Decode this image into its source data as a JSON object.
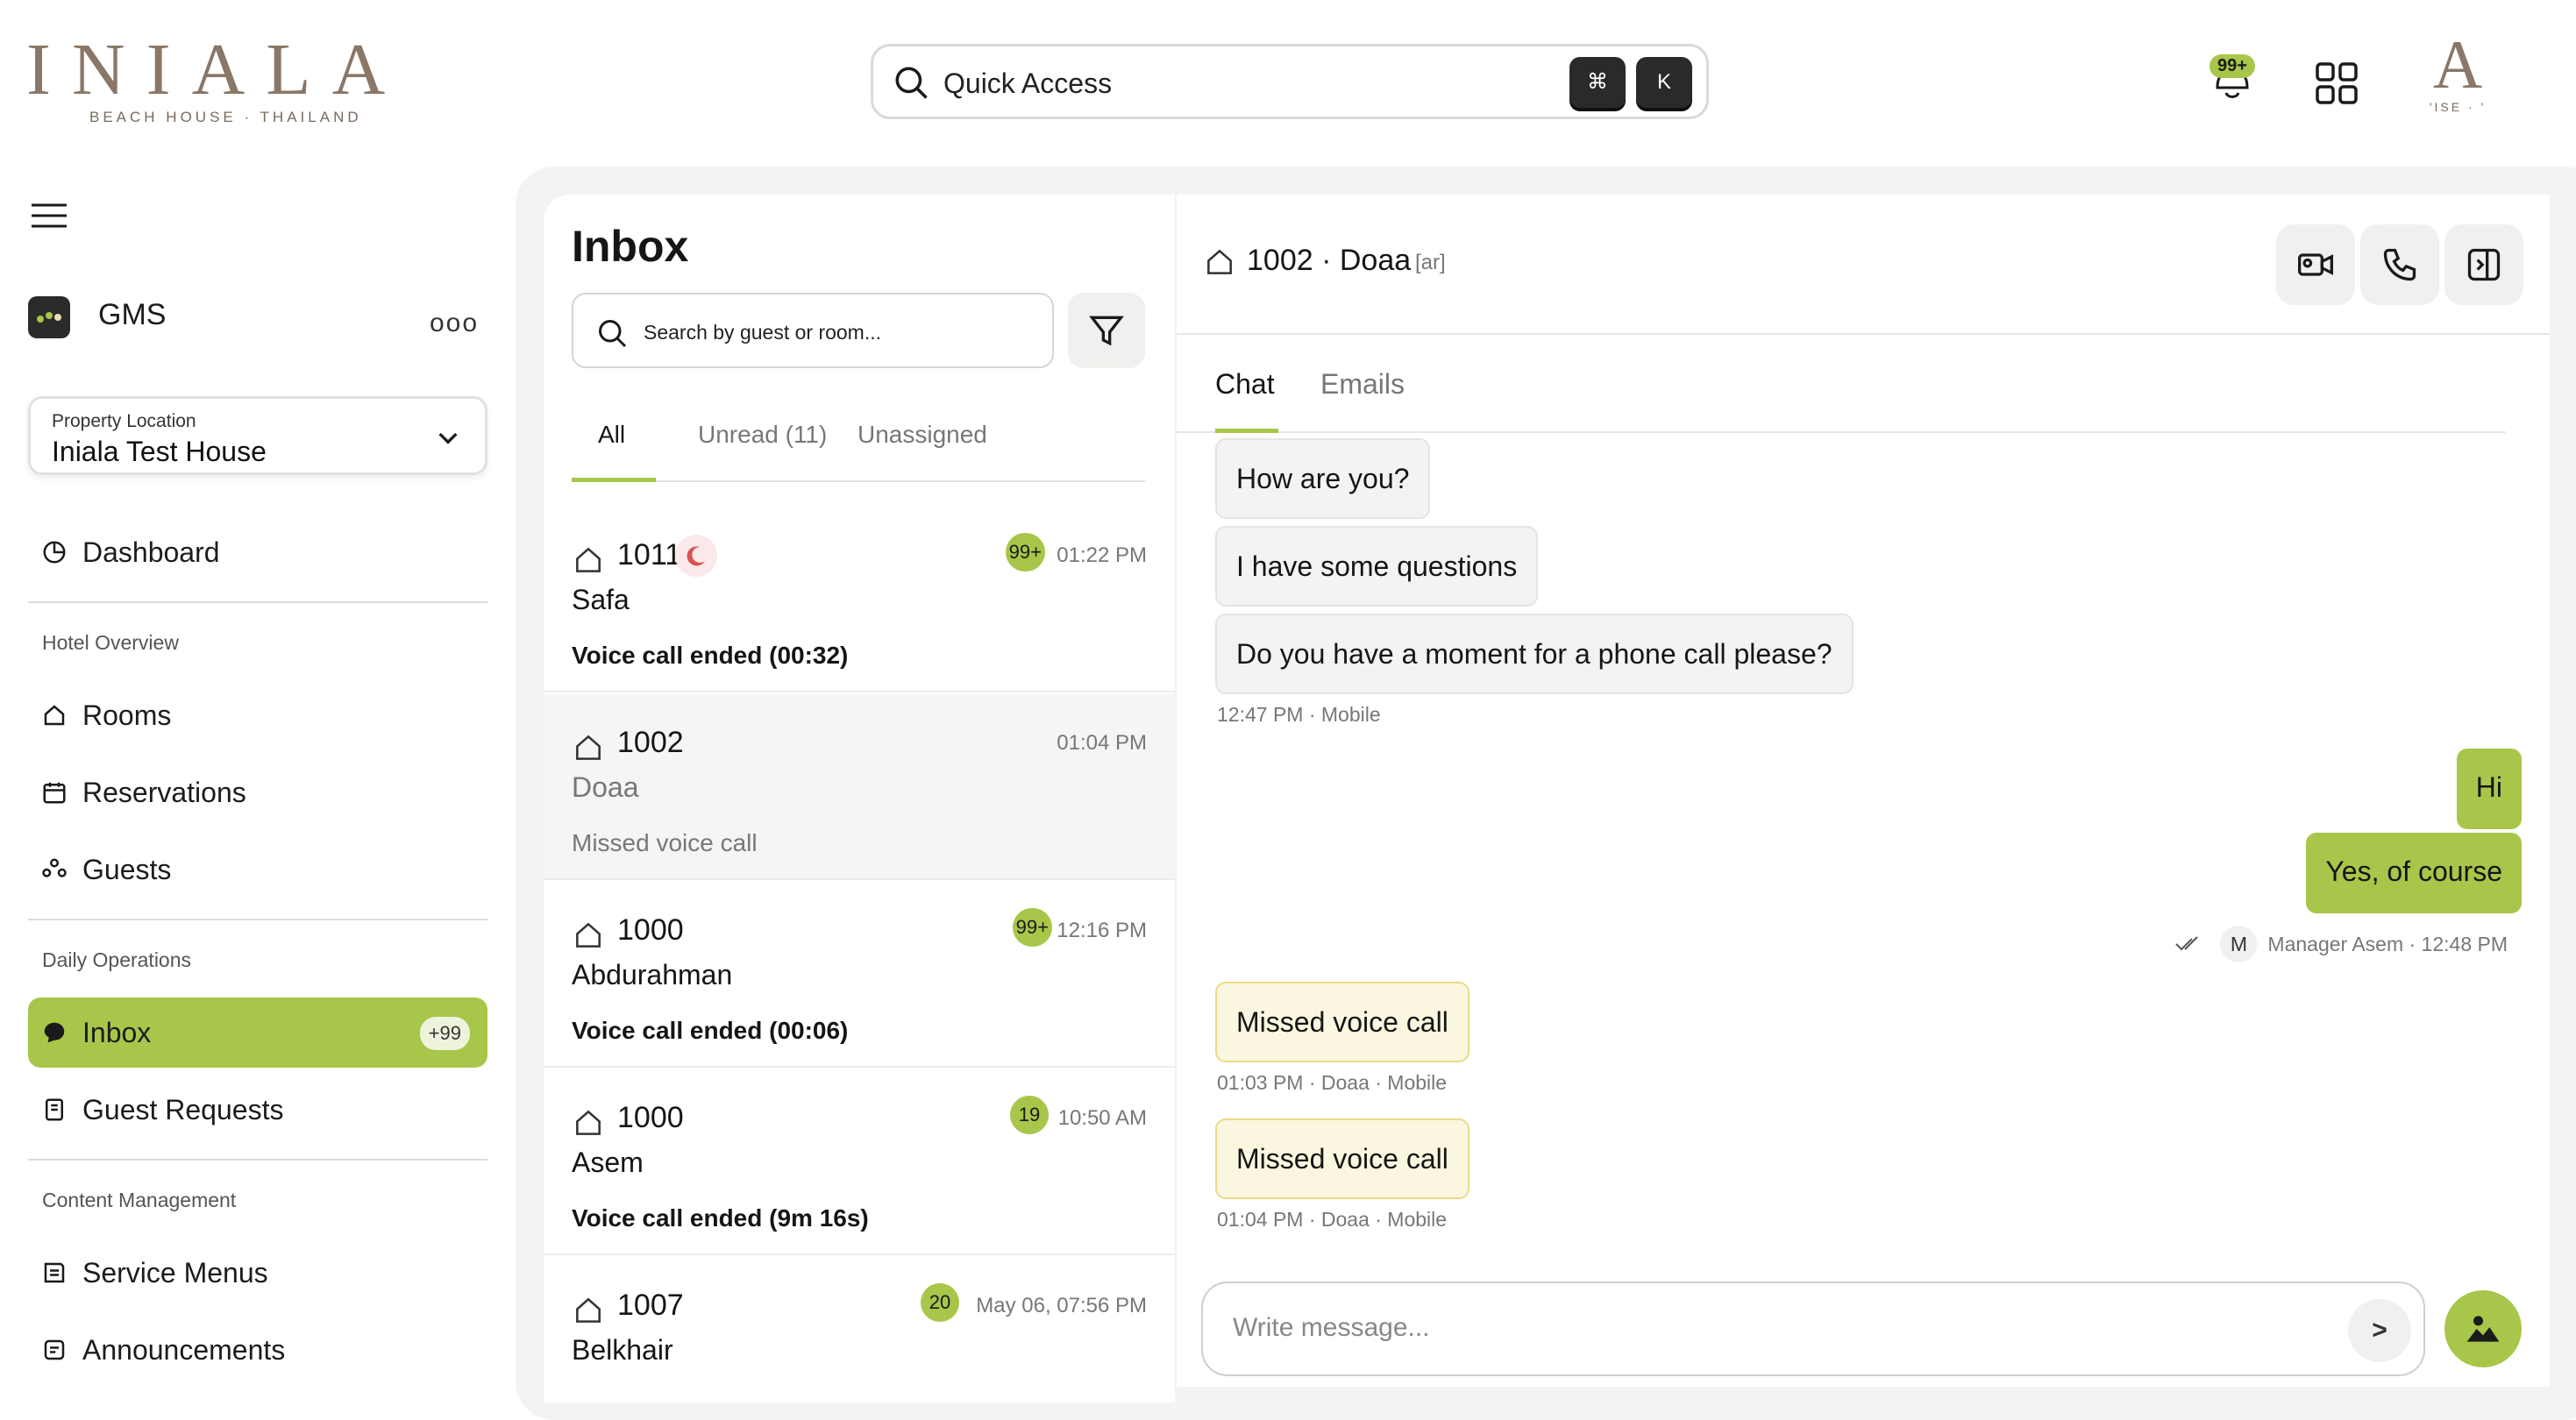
{
  "brand": {
    "logo_text": "INIALA",
    "logo_sub": "BEACH HOUSE · THAILAND",
    "mini_logo": "A",
    "mini_sub": "'ISE · '"
  },
  "topbar": {
    "quick_access_label": "Quick Access",
    "shortcut_keys": [
      "⌘",
      "K"
    ],
    "notification_badge": "99+",
    "icons": [
      "search-icon",
      "bell-icon",
      "grid-icon"
    ]
  },
  "sidebar": {
    "app_name": "GMS",
    "more": "ooo",
    "property": {
      "caption": "Property Location",
      "value": "Iniala Test House"
    },
    "items": [
      {
        "label": "Dashboard",
        "icon": "pie-chart-icon"
      },
      {
        "section": "Hotel Overview"
      },
      {
        "label": "Rooms",
        "icon": "house-icon"
      },
      {
        "label": "Reservations",
        "icon": "calendar-icon"
      },
      {
        "label": "Guests",
        "icon": "users-icon"
      },
      {
        "section": "Daily Operations"
      },
      {
        "label": "Inbox",
        "icon": "chat-icon",
        "badge": "+99",
        "active": true
      },
      {
        "label": "Guest Requests",
        "icon": "clipboard-icon"
      },
      {
        "section": "Content Management"
      },
      {
        "label": "Service Menus",
        "icon": "menu-book-icon"
      },
      {
        "label": "Announcements",
        "icon": "megaphone-icon"
      }
    ]
  },
  "inbox": {
    "title": "Inbox",
    "search_placeholder": "Search by guest or room...",
    "tabs": [
      "All",
      "Unread (11)",
      "Unassigned"
    ],
    "active_tab": "All",
    "conversations": [
      {
        "room": "1011",
        "guest": "Safa",
        "last": "Voice call ended (00:32)",
        "time": "01:22 PM",
        "badge": "99+",
        "unread": true,
        "dnd": true
      },
      {
        "room": "1002",
        "guest": "Doaa",
        "last": "Missed voice call",
        "time": "01:04 PM",
        "badge": "",
        "unread": false,
        "selected": true
      },
      {
        "room": "1000",
        "guest": "Abdurahman",
        "last": "Voice call ended (00:06)",
        "time": "12:16 PM",
        "badge": "99+",
        "unread": true
      },
      {
        "room": "1000",
        "guest": "Asem",
        "last": "Voice call ended (9m 16s)",
        "time": "10:50 AM",
        "badge": "19",
        "unread": true
      },
      {
        "room": "1007",
        "guest": "Belkhair",
        "last": "",
        "time": "May 06, 07:56 PM",
        "badge": "20",
        "unread": true
      }
    ]
  },
  "chat": {
    "room": "1002",
    "guest": "Doaa",
    "lang": "[ar]",
    "tabs": [
      "Chat",
      "Emails"
    ],
    "active_tab": "Chat",
    "messages": [
      {
        "dir": "in",
        "text": "How are you?"
      },
      {
        "dir": "in",
        "text": "I have some questions"
      },
      {
        "dir": "in",
        "text": "Do you have a moment for a phone call please?"
      },
      {
        "meta": "12:47 PM · Mobile"
      },
      {
        "dir": "out",
        "text": "Hi"
      },
      {
        "dir": "out",
        "text": "Yes, of course"
      },
      {
        "meta_out": {
          "avatar": "M",
          "text": "Manager Asem · 12:48 PM"
        }
      },
      {
        "dir": "missed",
        "text": "Missed voice call"
      },
      {
        "meta": "01:03 PM · Doaa · Mobile"
      },
      {
        "dir": "missed",
        "text": "Missed voice call"
      },
      {
        "meta": "01:04 PM · Doaa · Mobile"
      }
    ],
    "composer_placeholder": "Write message...",
    "send_label": ">"
  },
  "colors": {
    "accent": "#a8c64a",
    "brand": "#8a7767",
    "panel_bg": "#f3f3f1",
    "missed_bg": "#fbf6df"
  }
}
